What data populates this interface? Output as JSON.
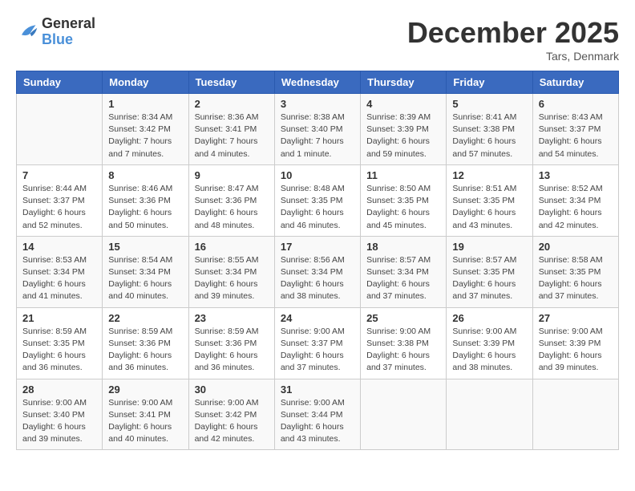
{
  "logo": {
    "line1": "General",
    "line2": "Blue"
  },
  "title": "December 2025",
  "location": "Tars, Denmark",
  "days_of_week": [
    "Sunday",
    "Monday",
    "Tuesday",
    "Wednesday",
    "Thursday",
    "Friday",
    "Saturday"
  ],
  "weeks": [
    [
      {
        "day": "",
        "sunrise": "",
        "sunset": "",
        "daylight": ""
      },
      {
        "day": "1",
        "sunrise": "Sunrise: 8:34 AM",
        "sunset": "Sunset: 3:42 PM",
        "daylight": "Daylight: 7 hours and 7 minutes."
      },
      {
        "day": "2",
        "sunrise": "Sunrise: 8:36 AM",
        "sunset": "Sunset: 3:41 PM",
        "daylight": "Daylight: 7 hours and 4 minutes."
      },
      {
        "day": "3",
        "sunrise": "Sunrise: 8:38 AM",
        "sunset": "Sunset: 3:40 PM",
        "daylight": "Daylight: 7 hours and 1 minute."
      },
      {
        "day": "4",
        "sunrise": "Sunrise: 8:39 AM",
        "sunset": "Sunset: 3:39 PM",
        "daylight": "Daylight: 6 hours and 59 minutes."
      },
      {
        "day": "5",
        "sunrise": "Sunrise: 8:41 AM",
        "sunset": "Sunset: 3:38 PM",
        "daylight": "Daylight: 6 hours and 57 minutes."
      },
      {
        "day": "6",
        "sunrise": "Sunrise: 8:43 AM",
        "sunset": "Sunset: 3:37 PM",
        "daylight": "Daylight: 6 hours and 54 minutes."
      }
    ],
    [
      {
        "day": "7",
        "sunrise": "Sunrise: 8:44 AM",
        "sunset": "Sunset: 3:37 PM",
        "daylight": "Daylight: 6 hours and 52 minutes."
      },
      {
        "day": "8",
        "sunrise": "Sunrise: 8:46 AM",
        "sunset": "Sunset: 3:36 PM",
        "daylight": "Daylight: 6 hours and 50 minutes."
      },
      {
        "day": "9",
        "sunrise": "Sunrise: 8:47 AM",
        "sunset": "Sunset: 3:36 PM",
        "daylight": "Daylight: 6 hours and 48 minutes."
      },
      {
        "day": "10",
        "sunrise": "Sunrise: 8:48 AM",
        "sunset": "Sunset: 3:35 PM",
        "daylight": "Daylight: 6 hours and 46 minutes."
      },
      {
        "day": "11",
        "sunrise": "Sunrise: 8:50 AM",
        "sunset": "Sunset: 3:35 PM",
        "daylight": "Daylight: 6 hours and 45 minutes."
      },
      {
        "day": "12",
        "sunrise": "Sunrise: 8:51 AM",
        "sunset": "Sunset: 3:35 PM",
        "daylight": "Daylight: 6 hours and 43 minutes."
      },
      {
        "day": "13",
        "sunrise": "Sunrise: 8:52 AM",
        "sunset": "Sunset: 3:34 PM",
        "daylight": "Daylight: 6 hours and 42 minutes."
      }
    ],
    [
      {
        "day": "14",
        "sunrise": "Sunrise: 8:53 AM",
        "sunset": "Sunset: 3:34 PM",
        "daylight": "Daylight: 6 hours and 41 minutes."
      },
      {
        "day": "15",
        "sunrise": "Sunrise: 8:54 AM",
        "sunset": "Sunset: 3:34 PM",
        "daylight": "Daylight: 6 hours and 40 minutes."
      },
      {
        "day": "16",
        "sunrise": "Sunrise: 8:55 AM",
        "sunset": "Sunset: 3:34 PM",
        "daylight": "Daylight: 6 hours and 39 minutes."
      },
      {
        "day": "17",
        "sunrise": "Sunrise: 8:56 AM",
        "sunset": "Sunset: 3:34 PM",
        "daylight": "Daylight: 6 hours and 38 minutes."
      },
      {
        "day": "18",
        "sunrise": "Sunrise: 8:57 AM",
        "sunset": "Sunset: 3:34 PM",
        "daylight": "Daylight: 6 hours and 37 minutes."
      },
      {
        "day": "19",
        "sunrise": "Sunrise: 8:57 AM",
        "sunset": "Sunset: 3:35 PM",
        "daylight": "Daylight: 6 hours and 37 minutes."
      },
      {
        "day": "20",
        "sunrise": "Sunrise: 8:58 AM",
        "sunset": "Sunset: 3:35 PM",
        "daylight": "Daylight: 6 hours and 37 minutes."
      }
    ],
    [
      {
        "day": "21",
        "sunrise": "Sunrise: 8:59 AM",
        "sunset": "Sunset: 3:35 PM",
        "daylight": "Daylight: 6 hours and 36 minutes."
      },
      {
        "day": "22",
        "sunrise": "Sunrise: 8:59 AM",
        "sunset": "Sunset: 3:36 PM",
        "daylight": "Daylight: 6 hours and 36 minutes."
      },
      {
        "day": "23",
        "sunrise": "Sunrise: 8:59 AM",
        "sunset": "Sunset: 3:36 PM",
        "daylight": "Daylight: 6 hours and 36 minutes."
      },
      {
        "day": "24",
        "sunrise": "Sunrise: 9:00 AM",
        "sunset": "Sunset: 3:37 PM",
        "daylight": "Daylight: 6 hours and 37 minutes."
      },
      {
        "day": "25",
        "sunrise": "Sunrise: 9:00 AM",
        "sunset": "Sunset: 3:38 PM",
        "daylight": "Daylight: 6 hours and 37 minutes."
      },
      {
        "day": "26",
        "sunrise": "Sunrise: 9:00 AM",
        "sunset": "Sunset: 3:39 PM",
        "daylight": "Daylight: 6 hours and 38 minutes."
      },
      {
        "day": "27",
        "sunrise": "Sunrise: 9:00 AM",
        "sunset": "Sunset: 3:39 PM",
        "daylight": "Daylight: 6 hours and 39 minutes."
      }
    ],
    [
      {
        "day": "28",
        "sunrise": "Sunrise: 9:00 AM",
        "sunset": "Sunset: 3:40 PM",
        "daylight": "Daylight: 6 hours and 39 minutes."
      },
      {
        "day": "29",
        "sunrise": "Sunrise: 9:00 AM",
        "sunset": "Sunset: 3:41 PM",
        "daylight": "Daylight: 6 hours and 40 minutes."
      },
      {
        "day": "30",
        "sunrise": "Sunrise: 9:00 AM",
        "sunset": "Sunset: 3:42 PM",
        "daylight": "Daylight: 6 hours and 42 minutes."
      },
      {
        "day": "31",
        "sunrise": "Sunrise: 9:00 AM",
        "sunset": "Sunset: 3:44 PM",
        "daylight": "Daylight: 6 hours and 43 minutes."
      },
      {
        "day": "",
        "sunrise": "",
        "sunset": "",
        "daylight": ""
      },
      {
        "day": "",
        "sunrise": "",
        "sunset": "",
        "daylight": ""
      },
      {
        "day": "",
        "sunrise": "",
        "sunset": "",
        "daylight": ""
      }
    ]
  ]
}
